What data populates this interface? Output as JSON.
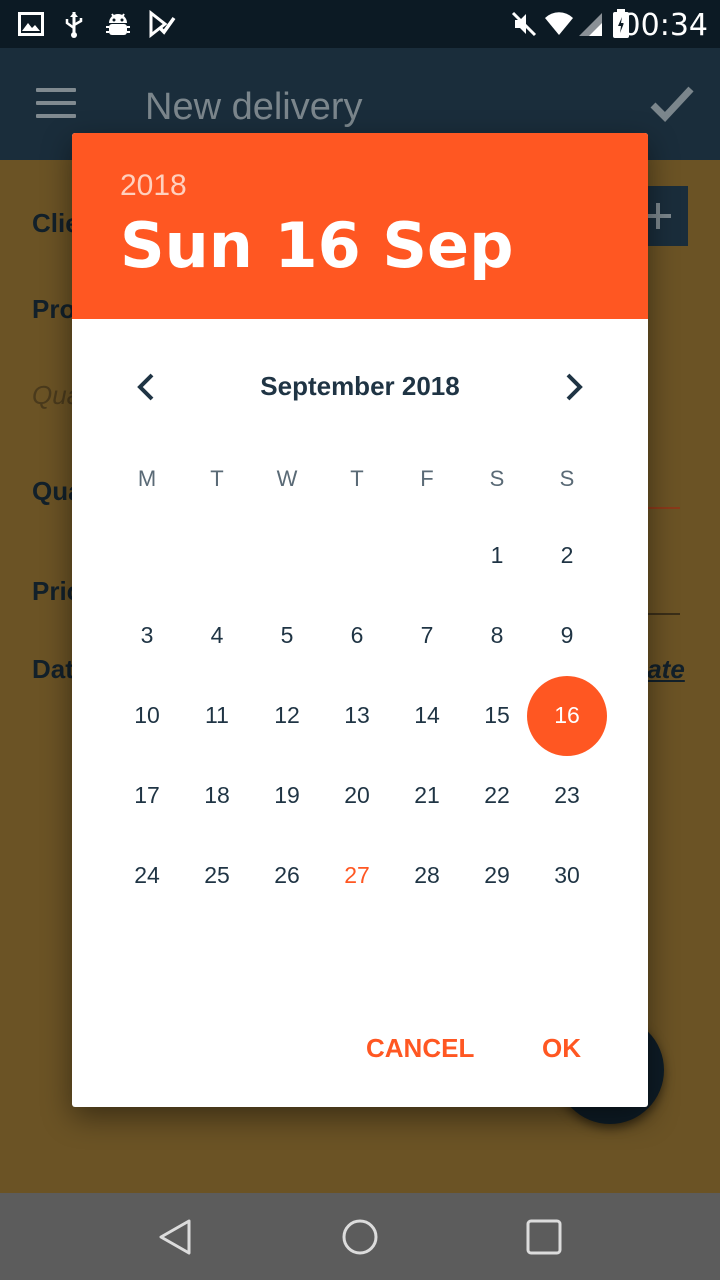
{
  "status_bar": {
    "time": "00:34",
    "left_icons": [
      "image-icon",
      "usb-icon",
      "android-debug-icon",
      "checklist-icon"
    ],
    "right_icons": [
      "mute-icon",
      "wifi-icon",
      "cell-signal-icon",
      "battery-icon"
    ]
  },
  "toolbar": {
    "title": "New delivery",
    "menu_icon": "menu-icon",
    "confirm_icon": "check-icon"
  },
  "form": {
    "labels": [
      "Clie",
      "Pro",
      "Qua",
      "Pric",
      "Dat"
    ],
    "quantity_placeholder": "Qua",
    "date_link": "late"
  },
  "dialog": {
    "year": "2018",
    "selected_date": "Sun 16 Sep",
    "month_title": "September 2018",
    "weekdays": [
      "M",
      "T",
      "W",
      "T",
      "F",
      "S",
      "S"
    ],
    "days": [
      "1",
      "2",
      "3",
      "4",
      "5",
      "6",
      "7",
      "8",
      "9",
      "10",
      "11",
      "12",
      "13",
      "14",
      "15",
      "16",
      "17",
      "18",
      "19",
      "20",
      "21",
      "22",
      "23",
      "24",
      "25",
      "26",
      "27",
      "28",
      "29",
      "30"
    ],
    "selected_day": "16",
    "today": "27",
    "cancel_label": "CANCEL",
    "ok_label": "OK"
  },
  "colors": {
    "accent": "#ff5722",
    "toolbar": "#1a2d3b",
    "text_dark": "#1f3444",
    "scrim_background": "#6b5325"
  }
}
